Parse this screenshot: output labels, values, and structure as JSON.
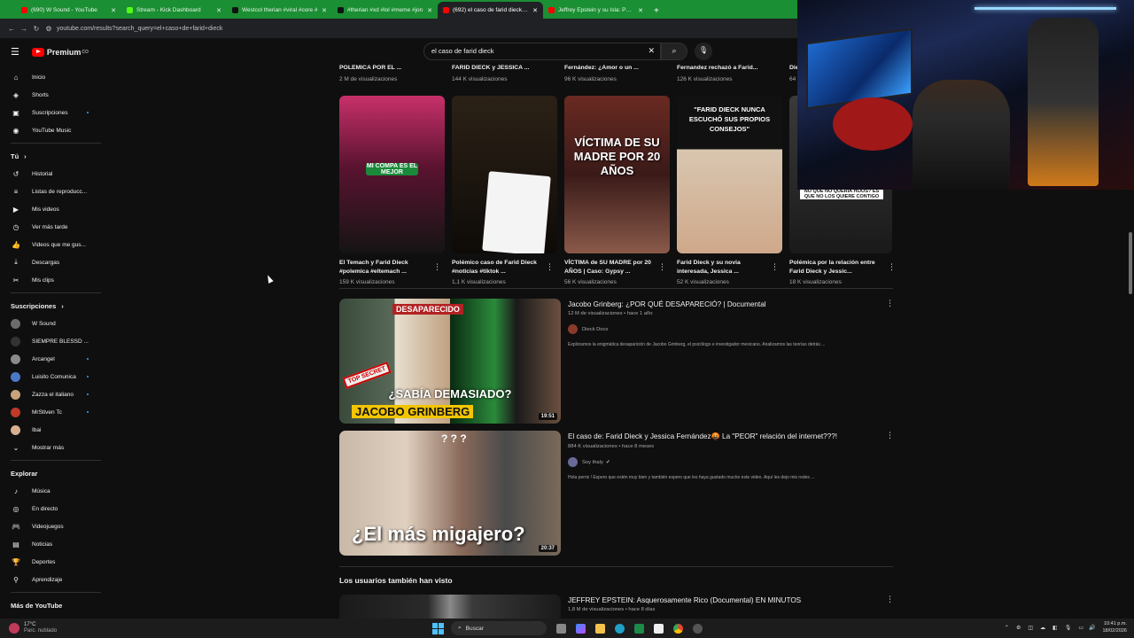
{
  "browser": {
    "tabs": [
      {
        "title": "(690) W Sound - YouTube",
        "color": "#ff0000"
      },
      {
        "title": "Stream - Kick Dashboard",
        "color": "#53fc18"
      },
      {
        "title": "Westcol therian #viral #core #",
        "color": "#111111"
      },
      {
        "title": "#therian #xd #lol #meme #jon",
        "color": "#111111"
      },
      {
        "title": "(692) el caso de farid dieck - Yo",
        "color": "#ff0000"
      },
      {
        "title": "Jeffrey Epstein y su Isla: Parte 1",
        "color": "#ff0000"
      }
    ],
    "active_tab": 4,
    "url": "youtube.com/results?search_query=el+caso+de+farid+dieck"
  },
  "youtube": {
    "logo_text": "Premium",
    "logo_super": "CO",
    "search_value": "el caso de farid dieck"
  },
  "sidebar": {
    "main": [
      {
        "label": "Inicio",
        "icon": "home-icon",
        "glyph": "⌂"
      },
      {
        "label": "Shorts",
        "icon": "shorts-icon",
        "glyph": "◈"
      },
      {
        "label": "Suscripciones",
        "icon": "subscriptions-icon",
        "glyph": "▣"
      },
      {
        "label": "YouTube Music",
        "icon": "music-icon",
        "glyph": "◉"
      }
    ],
    "you_header": "Tú",
    "you": [
      {
        "label": "Historial",
        "icon": "history-icon",
        "glyph": "↺"
      },
      {
        "label": "Listas de reproducc...",
        "icon": "playlists-icon",
        "glyph": "≡"
      },
      {
        "label": "Mis videos",
        "icon": "my-videos-icon",
        "glyph": "▶"
      },
      {
        "label": "Ver más tarde",
        "icon": "watch-later-icon",
        "glyph": "◷"
      },
      {
        "label": "Videos que me gus...",
        "icon": "liked-icon",
        "glyph": "👍"
      },
      {
        "label": "Descargas",
        "icon": "download-icon",
        "glyph": "⤓"
      },
      {
        "label": "Mis clips",
        "icon": "clips-icon",
        "glyph": "✂"
      }
    ],
    "subs_header": "Suscripciones",
    "subs": [
      {
        "label": "W Sound",
        "color": "#6b6b6b",
        "dot": false
      },
      {
        "label": "SIEMPRE BLESSD ...",
        "color": "#333333",
        "dot": false
      },
      {
        "label": "Arcangel",
        "color": "#8a8a8a",
        "dot": true
      },
      {
        "label": "Luisito Comunica",
        "color": "#4a78c8",
        "dot": true
      },
      {
        "label": "Zazza el italiano",
        "color": "#c9a27a",
        "dot": true
      },
      {
        "label": "MrStiven Tc",
        "color": "#c0392b",
        "dot": true
      },
      {
        "label": "Ibai",
        "color": "#d8b090",
        "dot": false
      }
    ],
    "show_more": "Mostrar más",
    "explore_header": "Explorar",
    "explore": [
      {
        "label": "Música",
        "icon": "music-note-icon",
        "glyph": "♪"
      },
      {
        "label": "En directo",
        "icon": "live-icon",
        "glyph": "◎"
      },
      {
        "label": "Videojuegos",
        "icon": "gaming-icon",
        "glyph": "🎮"
      },
      {
        "label": "Noticias",
        "icon": "news-icon",
        "glyph": "▤"
      },
      {
        "label": "Deportes",
        "icon": "trophy-icon",
        "glyph": "🏆"
      },
      {
        "label": "Aprendizaje",
        "icon": "learning-icon",
        "glyph": "⚲"
      }
    ],
    "more_header": "Más de YouTube"
  },
  "top_row": [
    {
      "title": "POLÉMICA POR EL ...",
      "views": "2 M de visualizaciones"
    },
    {
      "title": "FARID DIECK y JESSICA ...",
      "views": "144 K visualizaciones"
    },
    {
      "title": "Fernández: ¿Amor o un ...",
      "views": "96 K visualizaciones"
    },
    {
      "title": "Fernandez rechazó a Farid...",
      "views": "126 K visualizaciones"
    },
    {
      "title": "Die",
      "views": "64"
    }
  ],
  "shorts": [
    {
      "title": "El Temach y Farid Dieck #polemica #eltemach ...",
      "views": "159 K visualizaciones",
      "caption": "MI COMPA ES EL MEJOR",
      "bg": "linear-gradient(180deg,#c8306a 0%,#5b1330 45%,#141414 100%)"
    },
    {
      "title": "Polémico caso de Farid Dieck #noticias #tiktok ...",
      "views": "1,1 K visualizaciones",
      "caption": "",
      "bg": "linear-gradient(180deg,#2b2116 0%,#1a140e 60%,#0d0a07 100%)"
    },
    {
      "title": "VÍCTIMA de SU MADRE por 20 AÑOS | Caso: Gypsy ...",
      "views": "56 K visualizaciones",
      "caption": "VÍCTIMA DE SU MADRE POR 20 AÑOS",
      "bg": "linear-gradient(180deg,#6a2a22 0%,#3a1a18 50%,#8a5a4a 100%)"
    },
    {
      "title": "Farid Dieck y su novia interesada, Jessica ...",
      "views": "52 K visualizaciones",
      "caption": "\"FARID DIECK NUNCA ESCUCHÓ SUS PROPIOS CONSEJOS\"",
      "bg": "linear-gradient(180deg,#111111 0%,#111111 34%,#d9c6b0 34%,#cfa88a 100%)"
    },
    {
      "title": "Polémica por la relación entre Farid Dieck y Jessic...",
      "views": "18 K visualizaciones",
      "caption": "NO QUE NO QUERÍA HIJOS? ES QUE NO LOS QUIERE CONTIGO",
      "bg": "linear-gradient(180deg,#3a3a3a 0%,#1a1a1a 100%)"
    }
  ],
  "videos": [
    {
      "title": "Jacobo Grinberg: ¿POR QUÉ DESAPARECIÓ? | Documental",
      "meta": "12 M de visualizaciones • hace 1 año",
      "channel": "Dieck Docs",
      "channel_color": "#8a3a2a",
      "desc": "Exploramos la enigmática desaparición de Jacobo Grinberg, el psicólogo e investigador mexicano. Analizamos las teorías detrás ...",
      "duration": "19:51",
      "thumb_top": "DESAPARECIDO",
      "thumb_mid": "¿SABÍA DEMASIADO?",
      "thumb_bottom": "JACOBO GRINBERG",
      "thumb_stamp": "TOP SECRET"
    },
    {
      "title": "El caso de: Farid Dieck y Jessica Fernández🤬 La \"PEOR\" relación del internet???!",
      "meta": "884 K visualizaciones • hace 8 meses",
      "channel": "Soy thaly",
      "channel_color": "#6a6a9a",
      "desc": "Hola perris ! Espero que estén muy bien y también espero que les haya gustado mucho este video. Aquí les dejo mis redes ...",
      "duration": "20:37",
      "thumb_top": "? ? ?",
      "thumb_mid": "",
      "thumb_bottom": "¿El más migajero?",
      "thumb_stamp": ""
    }
  ],
  "section_title": "Los usuarios también han visto",
  "next_video": {
    "title": "JEFFREY EPSTEIN: Asquerosamente Rico (Documental) EN MINUTOS",
    "meta": "1,8 M de visualizaciones • hace 8 días"
  },
  "taskbar": {
    "weather_temp": "17°C",
    "weather_desc": "Parc. nublado",
    "search_label": "Buscar",
    "time": "10:41 p.m.",
    "date": "18/02/2026"
  }
}
